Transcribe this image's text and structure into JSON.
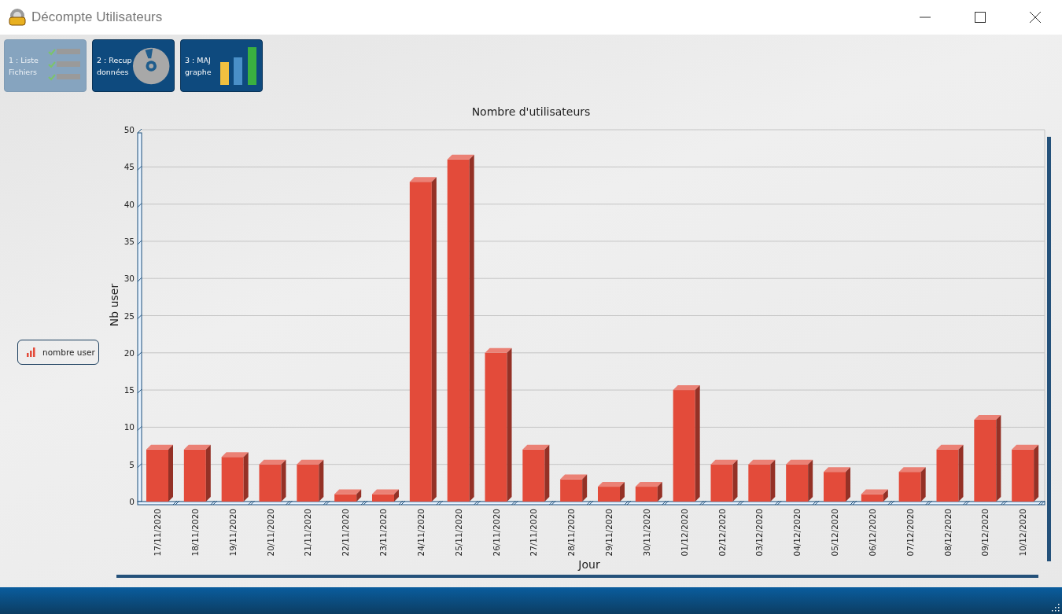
{
  "window": {
    "title": "Décompte Utilisateurs"
  },
  "toolbar": [
    {
      "lines": [
        "1 : Liste",
        "Fichiers"
      ],
      "kind": "list",
      "disabled": true
    },
    {
      "lines": [
        "2 : Recup",
        "données"
      ],
      "kind": "disc",
      "disabled": false
    },
    {
      "lines": [
        "3 : MAJ",
        "graphe"
      ],
      "kind": "bars",
      "disabled": false
    }
  ],
  "chart": {
    "chart_data": {
      "type": "bar",
      "title": "Nombre d'utilisateurs",
      "xlabel": "Jour",
      "ylabel": "Nb user",
      "categories": [
        "17/11/2020",
        "18/11/2020",
        "19/11/2020",
        "20/11/2020",
        "21/11/2020",
        "22/11/2020",
        "23/11/2020",
        "24/11/2020",
        "25/11/2020",
        "26/11/2020",
        "27/11/2020",
        "28/11/2020",
        "29/11/2020",
        "30/11/2020",
        "01/12/2020",
        "02/12/2020",
        "03/12/2020",
        "04/12/2020",
        "05/12/2020",
        "06/12/2020",
        "07/12/2020",
        "08/12/2020",
        "09/12/2020",
        "10/12/2020"
      ],
      "series": [
        {
          "name": "nombre user",
          "color": "#e34b3a",
          "values": [
            7,
            7,
            6,
            5,
            5,
            1,
            1,
            43,
            46,
            20,
            7,
            3,
            2,
            2,
            15,
            5,
            5,
            5,
            4,
            1,
            4,
            7,
            11,
            7
          ]
        }
      ],
      "ylim": [
        0,
        50
      ],
      "grid": true,
      "yticks": [
        0,
        5,
        10,
        15,
        20,
        25,
        30,
        35,
        40,
        45,
        50
      ]
    }
  }
}
